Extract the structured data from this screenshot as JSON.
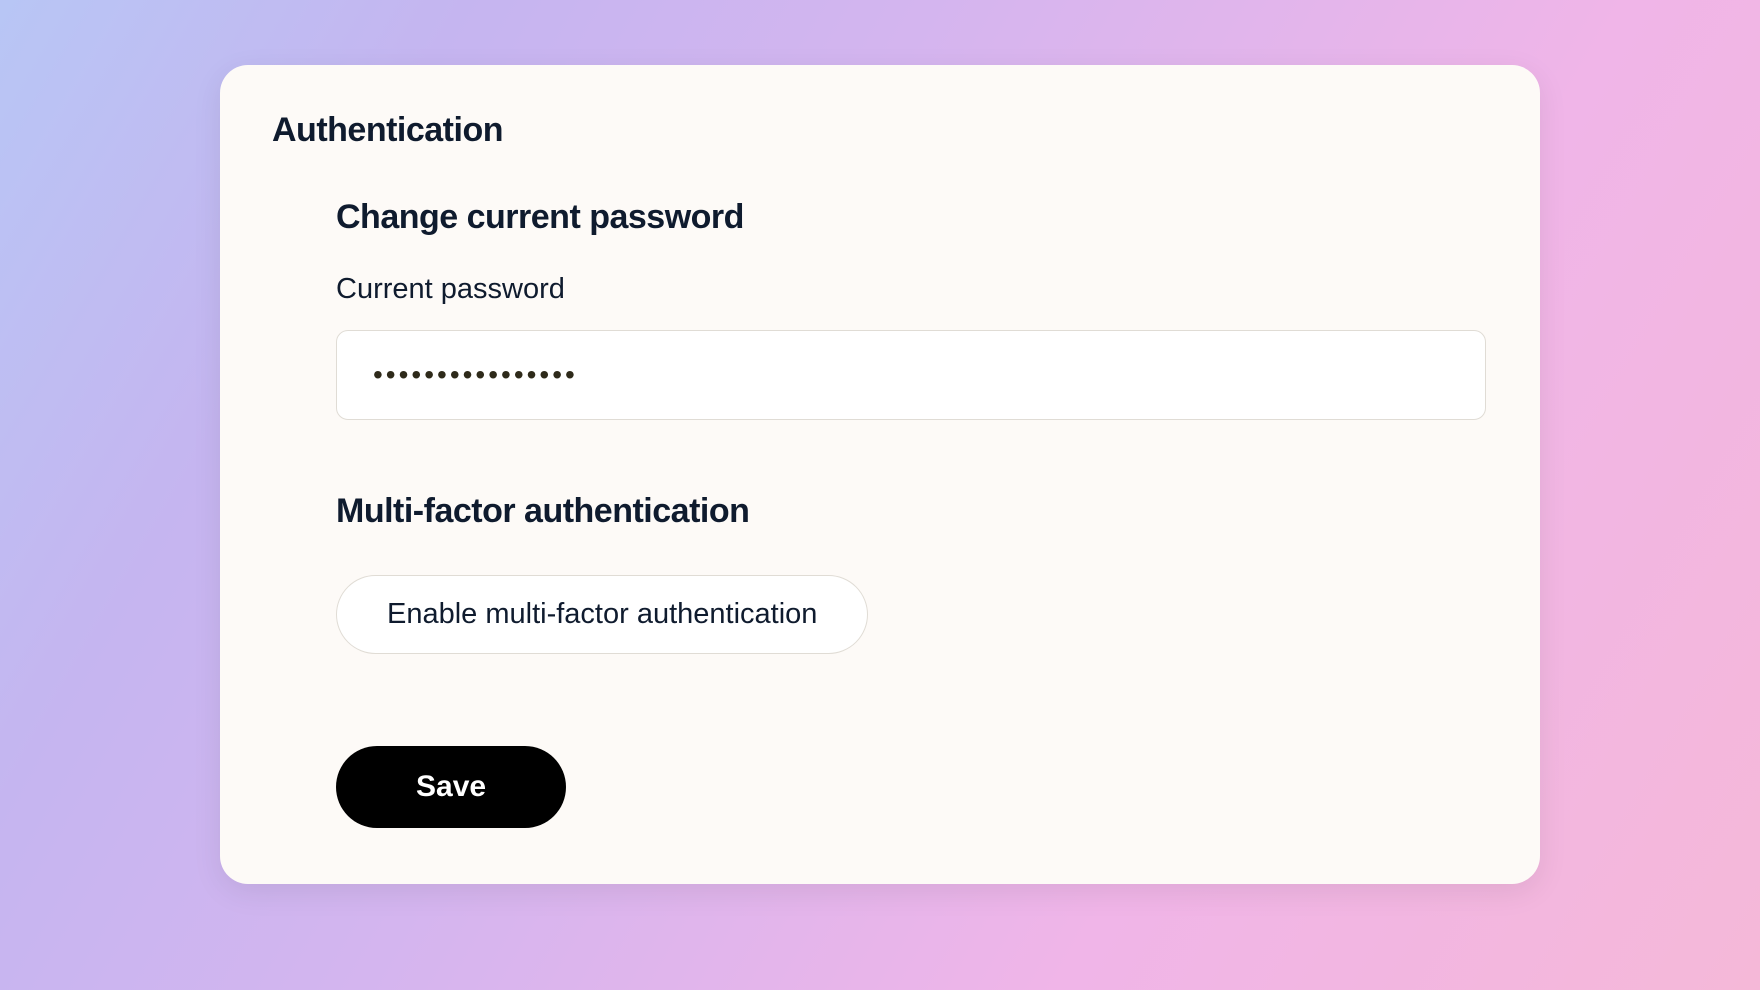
{
  "card": {
    "title": "Authentication"
  },
  "password_section": {
    "heading": "Change current password",
    "label": "Current password",
    "value": "passwordpassword"
  },
  "mfa_section": {
    "heading": "Multi-factor authentication",
    "button_label": "Enable multi-factor authentication"
  },
  "actions": {
    "save_label": "Save"
  }
}
